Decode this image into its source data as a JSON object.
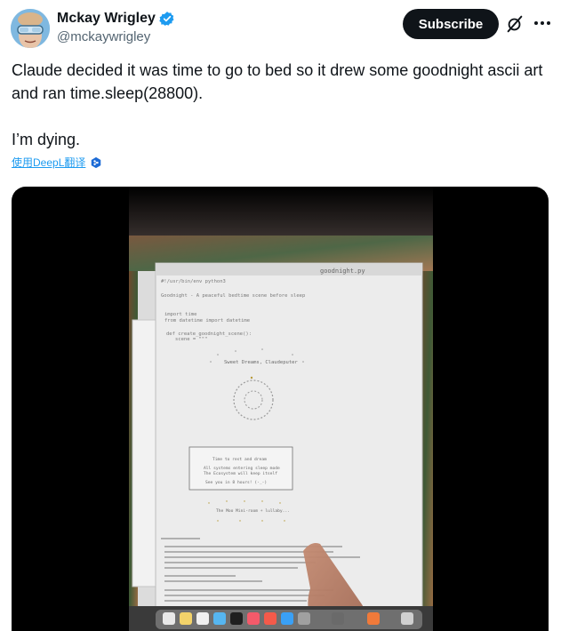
{
  "author": {
    "name": "Mckay Wrigley",
    "handle": "@mckaywrigley",
    "verified": true,
    "avatar_icon": "avatar-with-goggles"
  },
  "actions": {
    "subscribe_label": "Subscribe",
    "grok_icon": "grok-icon",
    "more_icon": "more-dots-icon"
  },
  "tweet": {
    "text_line1": "Claude decided it was time to go to bed so it drew some goodnight ascii art and ran time.sleep(28800).",
    "text_line2": "I’m dying.",
    "translate_label": "使用DeepL翻译",
    "translate_icon": "deepl-icon"
  },
  "video": {
    "screen_title": "goodnight.py",
    "code_line_1": "#!/usr/bin/env python3",
    "code_line_2": "Goodnight - A peaceful bedtime scene before sleep",
    "code_line_3": "import time",
    "code_line_4": "from datetime import datetime",
    "code_line_5": "def create_goodnight_scene():",
    "code_line_6": "scene = \"\"\"",
    "ascii_line_1": "Sweet Dreams, Claudeputer",
    "box_line_1": "Time to rest and dream",
    "box_line_2": "All systems entering sleep mode",
    "box_line_3": "The Ecosystem will keep itself",
    "box_line_4": "See you in 8 hours! (-_-)",
    "ascii_line_2": "The Moo Mini-room + lullaby...",
    "colors": {
      "background": "#000000",
      "window": "#ececec",
      "text": "#0f1419",
      "secondary": "#536471",
      "link": "#1d9bf0"
    }
  }
}
